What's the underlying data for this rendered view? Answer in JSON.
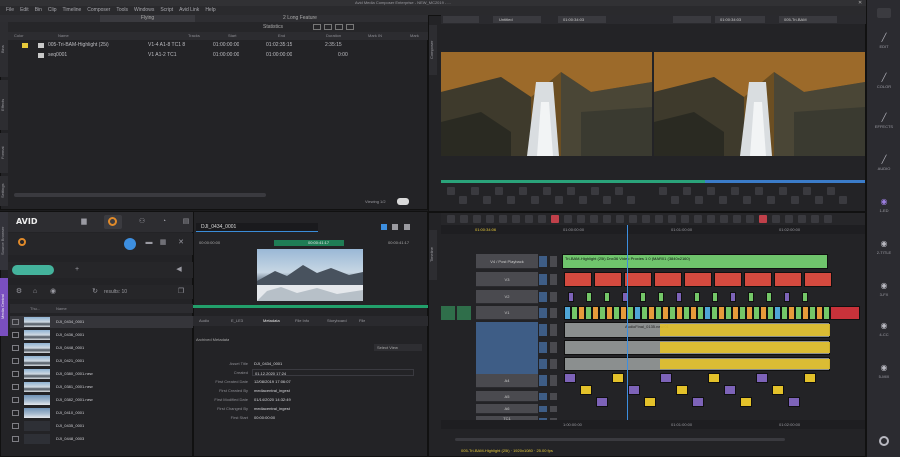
{
  "app": {
    "title": "Avid Media Composer Enterprise - NEW_MC2019 - ...",
    "menu": [
      "File",
      "Edit",
      "Bin",
      "Clip",
      "Timeline",
      "Composer",
      "Tools",
      "Windows",
      "Script",
      "Avid Link",
      "Help"
    ]
  },
  "bin": {
    "tab_left": "Flying",
    "tab_right": "2 Long Feature",
    "view": "Statistics",
    "columns": [
      "Color",
      "Name",
      "Tracks",
      "Start",
      "End",
      "Duration",
      "Mark IN",
      "Mark"
    ],
    "rows": [
      {
        "name": "005-Tri-BAM-Highlight (25i)",
        "tracks": "V1-4 A1-8 TC1 8",
        "start": "01:00:00:00",
        "end": "01:02:35:15",
        "duration": "2:35:15"
      },
      {
        "name": "seq0001",
        "tracks": "V1 A1-2 TC1",
        "start": "01:00:00:00",
        "end": "01:00:00:00",
        "duration": "0:00"
      }
    ],
    "status": "Viewing 1/2",
    "side_tabs": [
      "Bins",
      "Effects",
      "Format",
      "Settings"
    ]
  },
  "media_browser": {
    "search_label": "results: 10",
    "side_tabs": [
      "Source Browser",
      "Media Central"
    ],
    "columns": [
      "Thu...",
      "Name"
    ],
    "items": [
      {
        "name": "DJI_0434_0001",
        "thumb": "mountain"
      },
      {
        "name": "DJI_0436_0001",
        "thumb": "mountain"
      },
      {
        "name": "DJI_0448_0001",
        "thumb": "mountain"
      },
      {
        "name": "DJI_0421_0001",
        "thumb": "mountain"
      },
      {
        "name": "DJI_0380_0001.new",
        "thumb": "mountain"
      },
      {
        "name": "DJI_0381_0001.new",
        "thumb": "mountain"
      },
      {
        "name": "DJI_0382_0001.new",
        "thumb": "sky"
      },
      {
        "name": "DJI_0410_0001",
        "thumb": "sky"
      },
      {
        "name": "DJI_0435_0001",
        "thumb": "dark"
      },
      {
        "name": "DJI_0448_0003",
        "thumb": "dark"
      }
    ]
  },
  "inspector": {
    "clip_name": "DJI_0434_0001",
    "tc_left": "00:00:00:00",
    "tc_mid": "00:00:41:17",
    "tc_right": "00:00:41:17",
    "tabs": [
      "Audio",
      "E_LE3",
      "Metadata",
      "File Info",
      "Storyboard",
      "File"
    ],
    "section": "Archived Metadata",
    "select_view": "Select View",
    "fields": [
      {
        "label": "Asset Title",
        "value": "DJI_0434_0001"
      },
      {
        "label": "Created",
        "value": "01.12.2020 17:24"
      },
      {
        "label": "First Created Date",
        "value": "12/08/2019 17:06:07"
      },
      {
        "label": "First Created By",
        "value": "mediacentral_ingest"
      },
      {
        "label": "First Modified Date",
        "value": "01/14/2020 14:32:49"
      },
      {
        "label": "First Changed By",
        "value": "mediacentral_ingest"
      },
      {
        "label": "First Start",
        "value": "00:00:00:00"
      }
    ]
  },
  "composer": {
    "src_name": "Untitled",
    "rec_name": "005-Tri-BAM",
    "src_tc": "01:00:34:03",
    "rec_tc": "01:00:34:03",
    "src_side_tab": "Composer"
  },
  "timeline": {
    "tc_display": "01:00:34:06",
    "ruler": [
      "01:00:00:00",
      "01:01:00:00",
      "01:02:00:00"
    ],
    "ruler_bottom": [
      "1:00:00:00",
      "01:01:00:00",
      "01:02:00:00"
    ],
    "side_tab": "Timeline",
    "tracks": [
      {
        "name": "V4 / Post Playback",
        "sel": false
      },
      {
        "name": "V3",
        "sel": false
      },
      {
        "name": "V2",
        "sel": false
      },
      {
        "name": "V1",
        "sel": false
      },
      {
        "name": "A1",
        "sel": true
      },
      {
        "name": "A2",
        "sel": true
      },
      {
        "name": "A3",
        "sel": true
      },
      {
        "name": "A4",
        "sel": false
      },
      {
        "name": "A5",
        "sel": false
      },
      {
        "name": "A6",
        "sel": false
      },
      {
        "name": "TC1",
        "sel": false
      }
    ],
    "v4_clip": "Tri-BAM-Highlight (25i) Dnx36 Video Proxies 1 0 (MAR01 (3840x2160)",
    "audio_clip": "AudioFinal_0135.new.01",
    "status_bar": "005-Tri-BAM-Highlight (25i) · 1920x1080 · 25.00 fps",
    "colors": {
      "v4": "#6fc46c",
      "v3": "#d44a3f",
      "v1_green": "#74c768",
      "v1_blue": "#4fa6d8",
      "audio": "#e3c12a",
      "audio_bg": "#8b8f8f",
      "purple": "#7d63b8",
      "sel_track": "#3e5d86"
    }
  },
  "right_toolbar": [
    "EDIT",
    "COLOR",
    "EFFECTS",
    "AUDIO",
    "1-ED",
    "2-TITLE",
    "3-FX",
    "4-CC",
    "5-MIX"
  ]
}
